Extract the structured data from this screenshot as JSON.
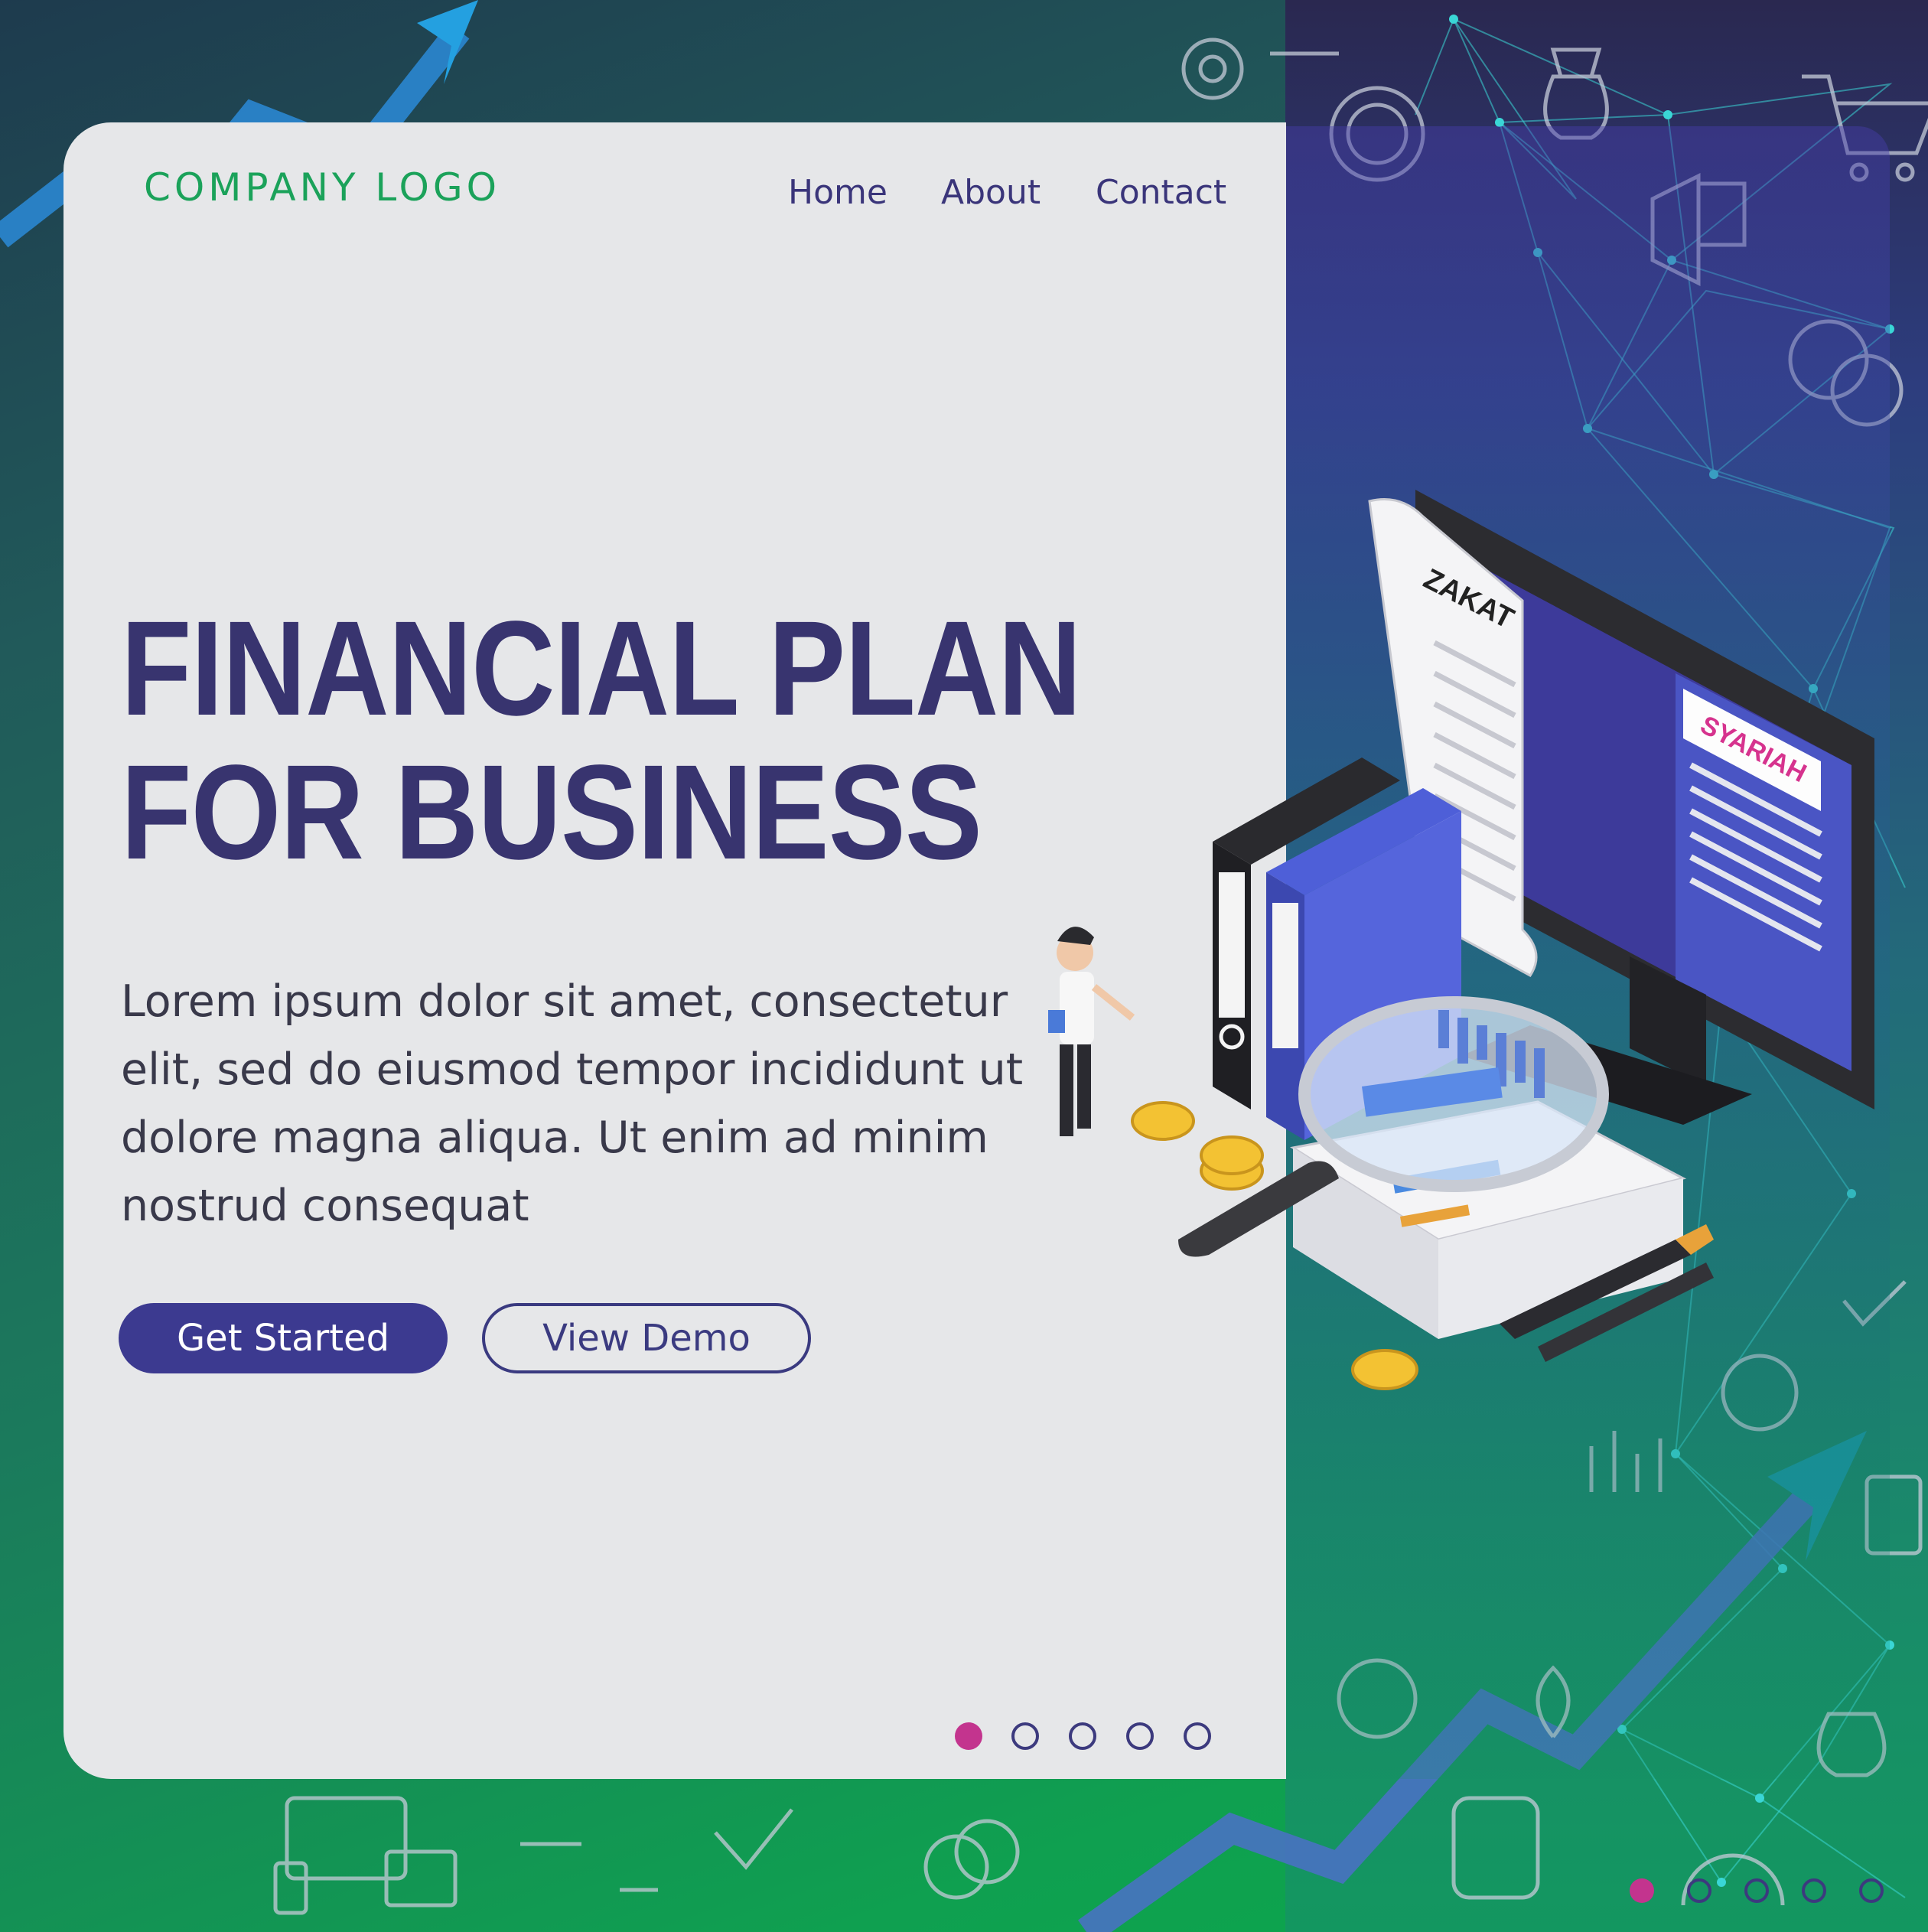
{
  "header": {
    "logo_text": "COMPANY LOGO",
    "nav": [
      {
        "label": "Home"
      },
      {
        "label": "About"
      },
      {
        "label": "Contact"
      }
    ]
  },
  "hero": {
    "headline_line1": "FINANCIAL PLAN",
    "headline_line2": "FOR BUSINESS",
    "description": "Lorem ipsum dolor sit amet, consectetur elit, sed do eiusmod tempor incididunt ut dolore magna aliqua. Ut enim ad minim nostrud consequat",
    "primary_button": "Get Started",
    "secondary_button": "View Demo"
  },
  "carousel": {
    "total": 5,
    "active_index": 0
  },
  "illustration": {
    "receipt_label": "ZAKAT",
    "screen_label": "SYARIAH"
  },
  "colors": {
    "brand_green": "#1ba25a",
    "navy": "#38346f",
    "accent_magenta": "#c3348e",
    "button_blue": "#3c3a90",
    "card_bg": "#e6e7e9"
  }
}
